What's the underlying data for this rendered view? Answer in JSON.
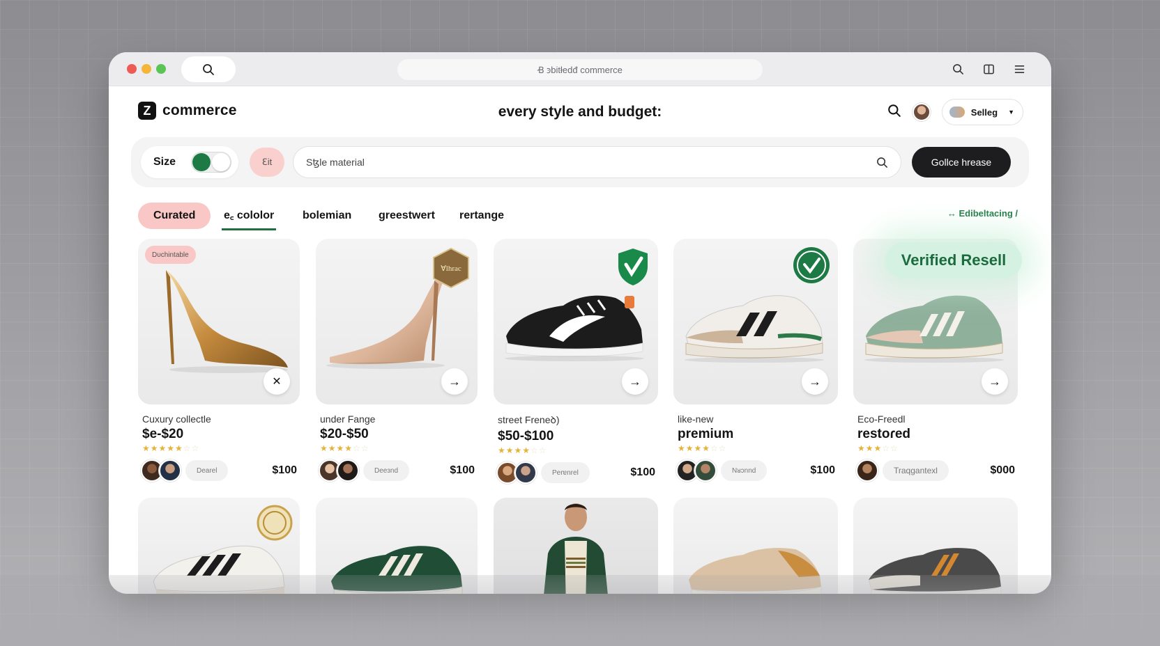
{
  "browser": {
    "url": "Ꞗ ꜿbitłedđ commerce"
  },
  "header": {
    "logo_mark": "Z",
    "logo_text": "commerce",
    "title": "every style and budget:",
    "selling_label": "Selleg"
  },
  "filters": {
    "size_label": "Size",
    "fit_label": "Ꜫit",
    "search_value": "Sꜩle material",
    "collect_label": "Gollce hrease"
  },
  "tabs": {
    "items": [
      "Curated",
      "e꜀ cololor",
      "bolemian",
      "greestwert",
      "rertange"
    ],
    "right_link": "Edibeltacing /"
  },
  "cards": [
    {
      "tag": "Dᴜchintable",
      "subtitle": "Cuxury collectle",
      "price_range": "$e-$20",
      "chip": "Dearel",
      "price": "$100",
      "stars": "★★★★★",
      "stars_faint": "☆☆"
    },
    {
      "badge": "Ɐlhrac",
      "subtitle": "under Fange",
      "price_range": "$20-$50",
      "chip": "Deeɜnd",
      "price": "$100",
      "stars": "★★★★",
      "stars_faint": "☆☆"
    },
    {
      "subtitle": "street Freneꝺ)",
      "price_range": "$50-$100",
      "chip": "Perɐnrel",
      "price": "$100",
      "stars": "★★★★",
      "stars_faint": "☆☆"
    },
    {
      "subtitle": "like-new",
      "price_range": "premium",
      "chip": "Nᴚɔnnd",
      "price": "$100",
      "stars": "★★★★",
      "stars_faint": "☆☆"
    },
    {
      "verified": "Verified Resell",
      "subtitle": "Eco-Freedl",
      "price_range": "restoɾed",
      "chip": "Traqgantexl",
      "price": "$000",
      "stars": "★★★",
      "stars_faint": "☆☆"
    }
  ],
  "colors": {
    "accent_green": "#1d7a45",
    "pink": "#f9c8c6",
    "dark_button": "#1d1d1f"
  }
}
